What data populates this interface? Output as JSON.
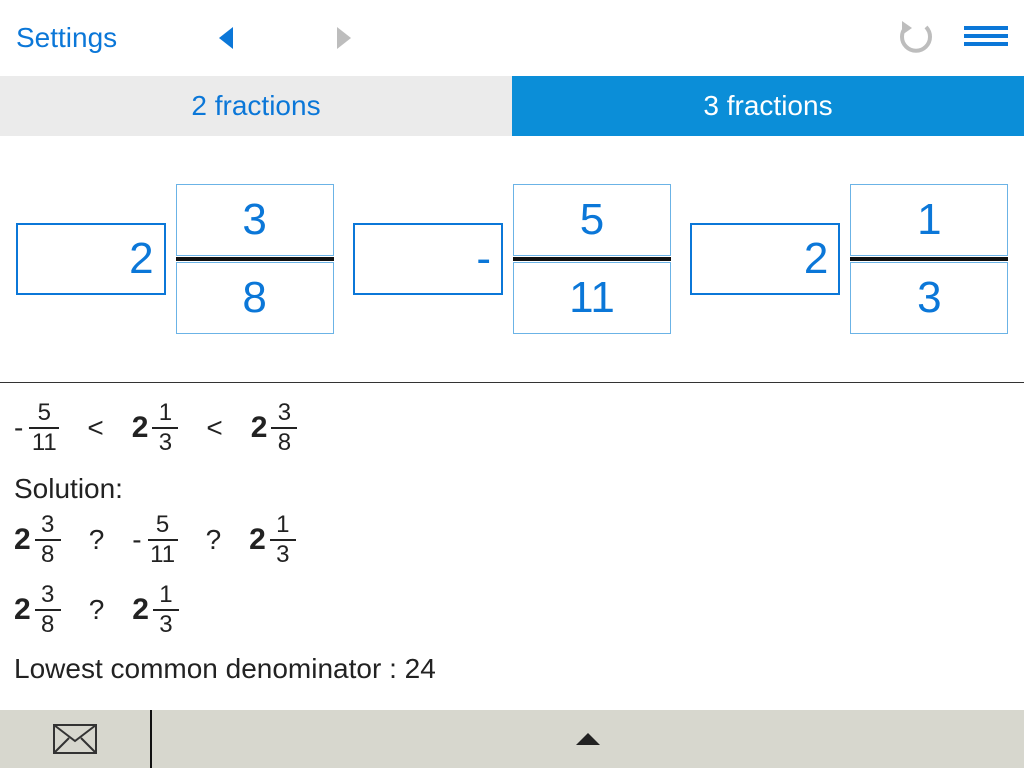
{
  "topbar": {
    "settings_label": "Settings"
  },
  "tabs": {
    "two": "2 fractions",
    "three": "3 fractions",
    "active": "three"
  },
  "inputs": {
    "f1": {
      "whole": "2",
      "num": "3",
      "den": "8"
    },
    "f2": {
      "whole": "-",
      "num": "5",
      "den": "11"
    },
    "f3": {
      "whole": "2",
      "num": "1",
      "den": "3"
    }
  },
  "result": {
    "order": [
      {
        "sign": "-",
        "whole": "",
        "num": "5",
        "den": "11"
      },
      {
        "sign": "",
        "whole": "2",
        "num": "1",
        "den": "3"
      },
      {
        "sign": "",
        "whole": "2",
        "num": "3",
        "den": "8"
      }
    ],
    "comparator": "<",
    "solution_label": "Solution:",
    "line1": [
      {
        "sign": "",
        "whole": "2",
        "num": "3",
        "den": "8"
      },
      {
        "sign": "-",
        "whole": "",
        "num": "5",
        "den": "11"
      },
      {
        "sign": "",
        "whole": "2",
        "num": "1",
        "den": "3"
      }
    ],
    "q": "?",
    "line2": [
      {
        "sign": "",
        "whole": "2",
        "num": "3",
        "den": "8"
      },
      {
        "sign": "",
        "whole": "2",
        "num": "1",
        "den": "3"
      }
    ],
    "lcd_label": "Lowest common denominator : ",
    "lcd_value": "24"
  }
}
